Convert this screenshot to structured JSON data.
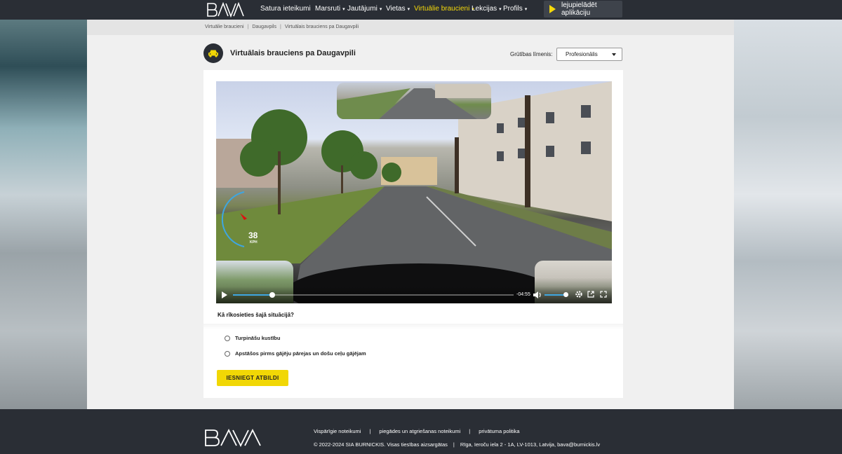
{
  "nav": {
    "logo_text": "BAVA",
    "items": [
      {
        "label": "Satura ieteikumi",
        "has_menu": false,
        "active": false
      },
      {
        "label": "Marsruti",
        "has_menu": true,
        "active": false
      },
      {
        "label": "Jautājumi",
        "has_menu": true,
        "active": false
      },
      {
        "label": "Vietas",
        "has_menu": true,
        "active": false
      },
      {
        "label": "Virtuālie braucieni",
        "has_menu": true,
        "active": true
      },
      {
        "label": "Lekcijas",
        "has_menu": true,
        "active": false
      },
      {
        "label": "Profils",
        "has_menu": true,
        "active": false
      }
    ],
    "caret": "▾",
    "app_button_label": "lejupielādēt aplikāciju"
  },
  "breadcrumb": {
    "items": [
      "Virtuālie braucieni",
      "Daugavpils",
      "Virtuālais brauciens pa Daugavpili"
    ],
    "separator": "|"
  },
  "header": {
    "title": "Virtuālais brauciens pa Daugavpili",
    "level_label": "Grūtības līmenis:",
    "level_value": "Profesionālis"
  },
  "video": {
    "speed": "38",
    "speed_unit": "KPH",
    "time": "-04:55",
    "progress_fraction": 0.14,
    "volume_fraction": 0.9
  },
  "quiz": {
    "question": "Kā rīkosieties šajā situācijā?",
    "options": [
      "Turpināšu kustību",
      "Apstāšos pirms gājēju pārejas un došu ceļu gājējam"
    ],
    "submit_label": "IESNIEGT ATBILDI"
  },
  "footer": {
    "links": [
      "Vispārīgie noteikumi",
      "piegādes un atgriešanas noteikumi",
      "privātuma politika"
    ],
    "copyright": "© 2022-2024 SIA BURNICKIS. Visas tiesības aizsargātas",
    "address": "Rīga, Ieroču iela 2 - 1A, LV-1013, Latvija, bava@burnickis.lv",
    "separator": "|"
  },
  "colors": {
    "nav_bg": "#2a2e35",
    "accent_yellow": "#f1d705",
    "progress_blue": "#3ea6e0"
  }
}
